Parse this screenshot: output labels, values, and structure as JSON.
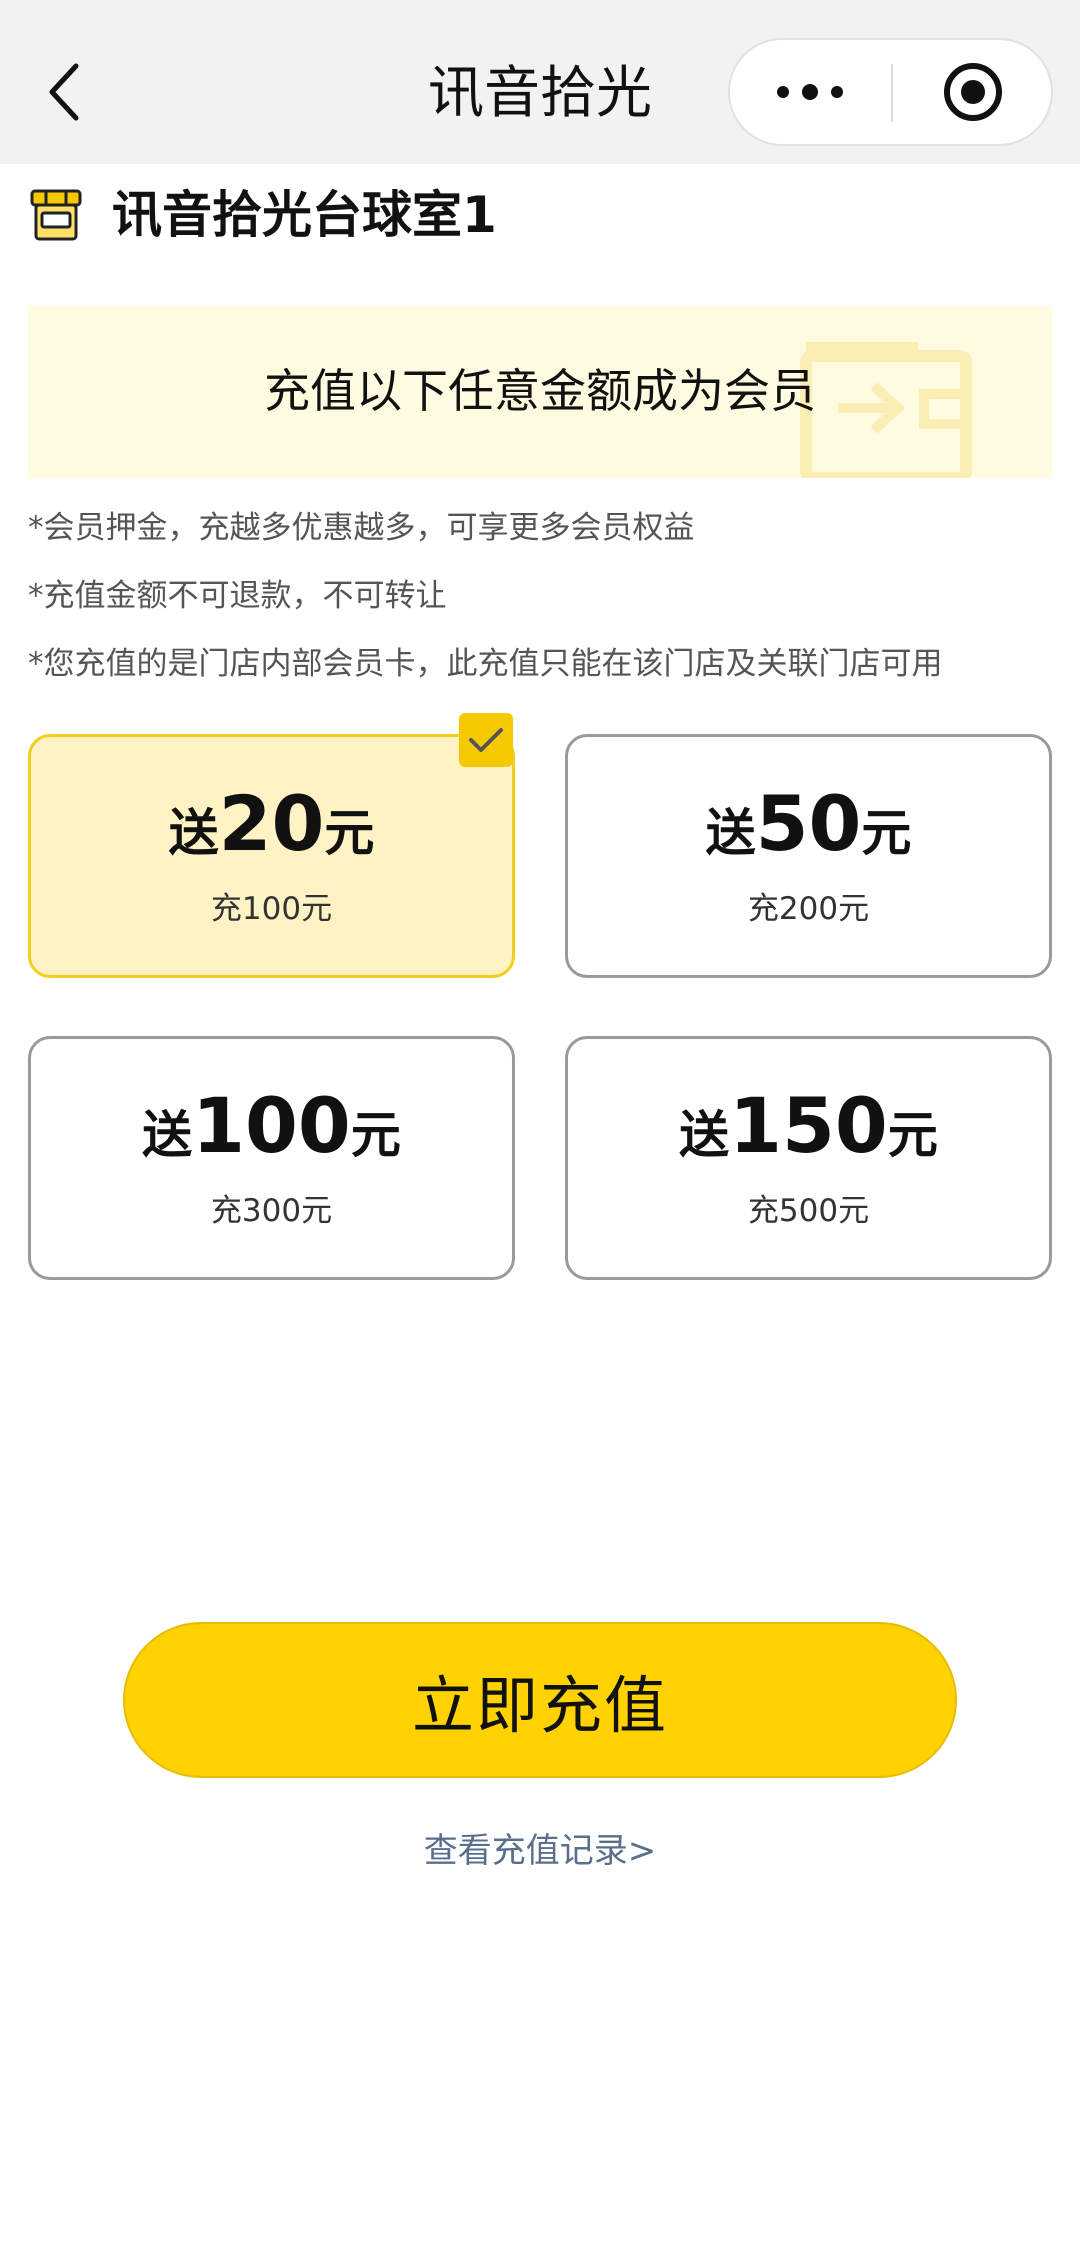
{
  "navbar": {
    "title": "讯音拾光",
    "back_icon": "chevron-left-icon",
    "more_icon": "more-dots-icon",
    "close_icon": "record-circle-icon"
  },
  "store": {
    "icon": "storefront-icon",
    "name": "讯音拾光台球室1"
  },
  "banner": {
    "text": "充值以下任意金额成为会员",
    "decor_icon": "wallet-transfer-icon"
  },
  "notes": [
    "*会员押金，充越多优惠越多，可享更多会员权益",
    "*充值金额不可退款，不可转让",
    "*您充值的是门店内部会员卡，此充值只能在该门店及关联门店可用"
  ],
  "options": [
    {
      "prefix": "送",
      "amount": "20",
      "suffix": "元",
      "pay": "充100元",
      "selected": true
    },
    {
      "prefix": "送",
      "amount": "50",
      "suffix": "元",
      "pay": "充200元",
      "selected": false
    },
    {
      "prefix": "送",
      "amount": "100",
      "suffix": "元",
      "pay": "充300元",
      "selected": false
    },
    {
      "prefix": "送",
      "amount": "150",
      "suffix": "元",
      "pay": "充500元",
      "selected": false
    }
  ],
  "actions": {
    "recharge_label": "立即充值",
    "records_link": "查看充值记录>"
  },
  "colors": {
    "accent": "#ffd200",
    "selected_bg": "#fff3c6",
    "banner_bg": "#fffbe0",
    "link": "#5a6f8c"
  }
}
